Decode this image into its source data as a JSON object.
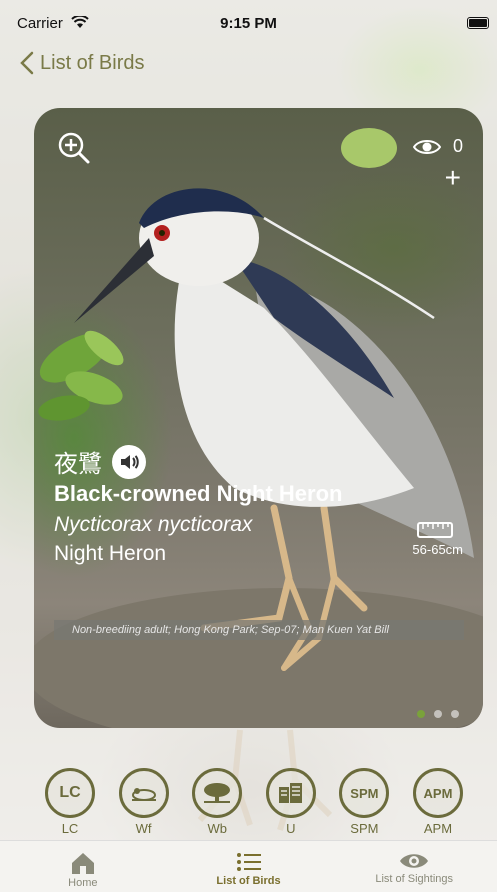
{
  "status_bar": {
    "carrier": "Carrier",
    "time": "9:15 PM"
  },
  "nav": {
    "back_label": "List of Birds"
  },
  "card": {
    "view_count": "0",
    "chinese_name": "夜鷺",
    "english_name": "Black-crowned Night Heron",
    "scientific_name": "Nycticorax nycticorax",
    "common_name": "Night Heron",
    "size": "56-65cm",
    "caption": "Non-breediing adult; Hong Kong Park; Sep-07; Man Kuen Yat Bill",
    "pages": 3,
    "current_page": 1
  },
  "badges": [
    {
      "code": "LC",
      "label": "LC",
      "icon": "lc-icon"
    },
    {
      "code": "Wf",
      "label": "Wf",
      "icon": "wetland-bird-icon"
    },
    {
      "code": "Wb",
      "label": "Wb",
      "icon": "woodland-icon"
    },
    {
      "code": "U",
      "label": "U",
      "icon": "urban-icon"
    },
    {
      "code": "SPM",
      "label": "SPM",
      "icon": "spm-icon"
    },
    {
      "code": "APM",
      "label": "APM",
      "icon": "apm-icon"
    }
  ],
  "tabs": [
    {
      "label": "Home",
      "icon": "home-icon"
    },
    {
      "label": "List of Birds",
      "icon": "list-icon",
      "active": true
    },
    {
      "label": "List of Sightings",
      "icon": "eye-icon"
    }
  ],
  "colors": {
    "accent": "#6b6b3c",
    "tab_active": "#7a6f2e",
    "dot_active": "#7aa23a"
  }
}
